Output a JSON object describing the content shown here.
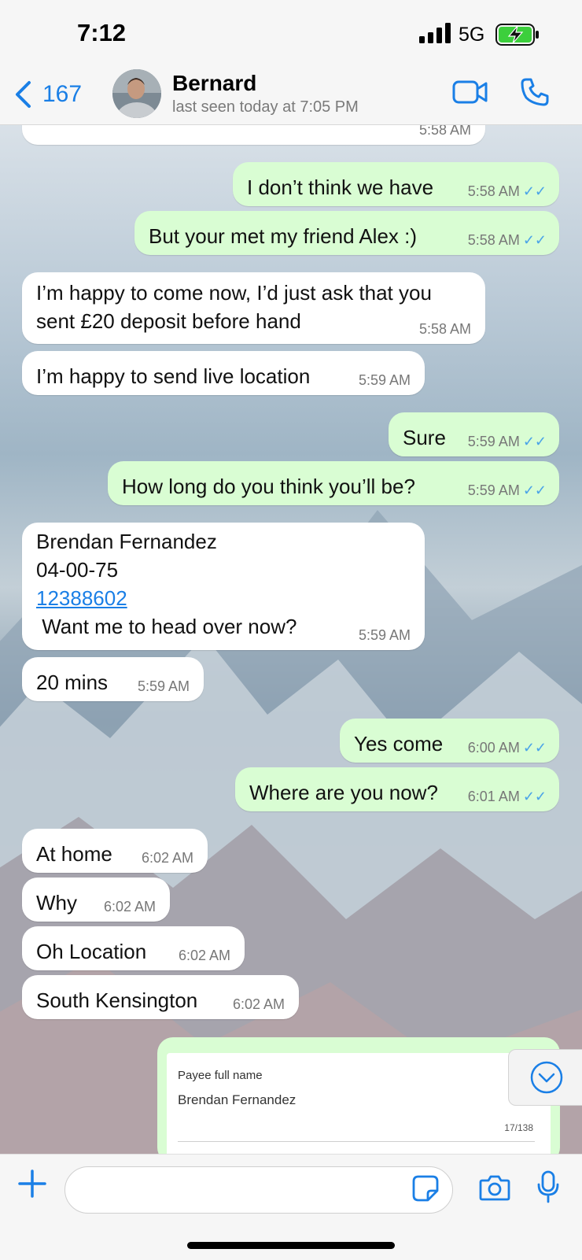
{
  "status_bar": {
    "time": "7:12",
    "network": "5G"
  },
  "header": {
    "back_count": "167",
    "contact_name": "Bernard",
    "last_seen": "last seen today at 7:05 PM"
  },
  "messages": [
    {
      "dir": "in",
      "text": "",
      "time": "5:58 AM"
    },
    {
      "dir": "out",
      "text": "I don’t think we have",
      "time": "5:58 AM"
    },
    {
      "dir": "out",
      "text": "But  your met my friend Alex :)",
      "time": "5:58 AM"
    },
    {
      "dir": "in",
      "line1": "I’m happy to come now, I’d just ask that you",
      "line2": "sent £20 deposit before hand",
      "time": "5:58 AM"
    },
    {
      "dir": "in",
      "text": "I’m happy to send live location",
      "time": "5:59 AM"
    },
    {
      "dir": "out",
      "text": "Sure",
      "time": "5:59 AM"
    },
    {
      "dir": "out",
      "text": "How long do you think you’ll be?",
      "time": "5:59 AM"
    },
    {
      "dir": "in",
      "line1": "Brendan Fernandez",
      "line2": "04-00-75",
      "link": "12388602",
      "line4": " Want me to head over now?",
      "time": "5:59 AM"
    },
    {
      "dir": "in",
      "text": "20 mins",
      "time": "5:59 AM"
    },
    {
      "dir": "out",
      "text": "Yes come",
      "time": "6:00 AM"
    },
    {
      "dir": "out",
      "text": "Where are you now?",
      "time": "6:01 AM"
    },
    {
      "dir": "in",
      "text": "At home",
      "time": "6:02 AM"
    },
    {
      "dir": "in",
      "text": "Why",
      "time": "6:02 AM"
    },
    {
      "dir": "in",
      "text": "Oh Location",
      "time": "6:02 AM"
    },
    {
      "dir": "in",
      "text": "South Kensington",
      "time": "6:02 AM"
    }
  ],
  "payment_form": {
    "label": "Payee full name",
    "value": "Brendan Fernandez",
    "counter": "17/138"
  },
  "colors": {
    "incoming": "#ffffff",
    "outgoing": "#d9fdd3",
    "accent": "#1a7fe6",
    "read_ticks": "#4aa3e8"
  }
}
